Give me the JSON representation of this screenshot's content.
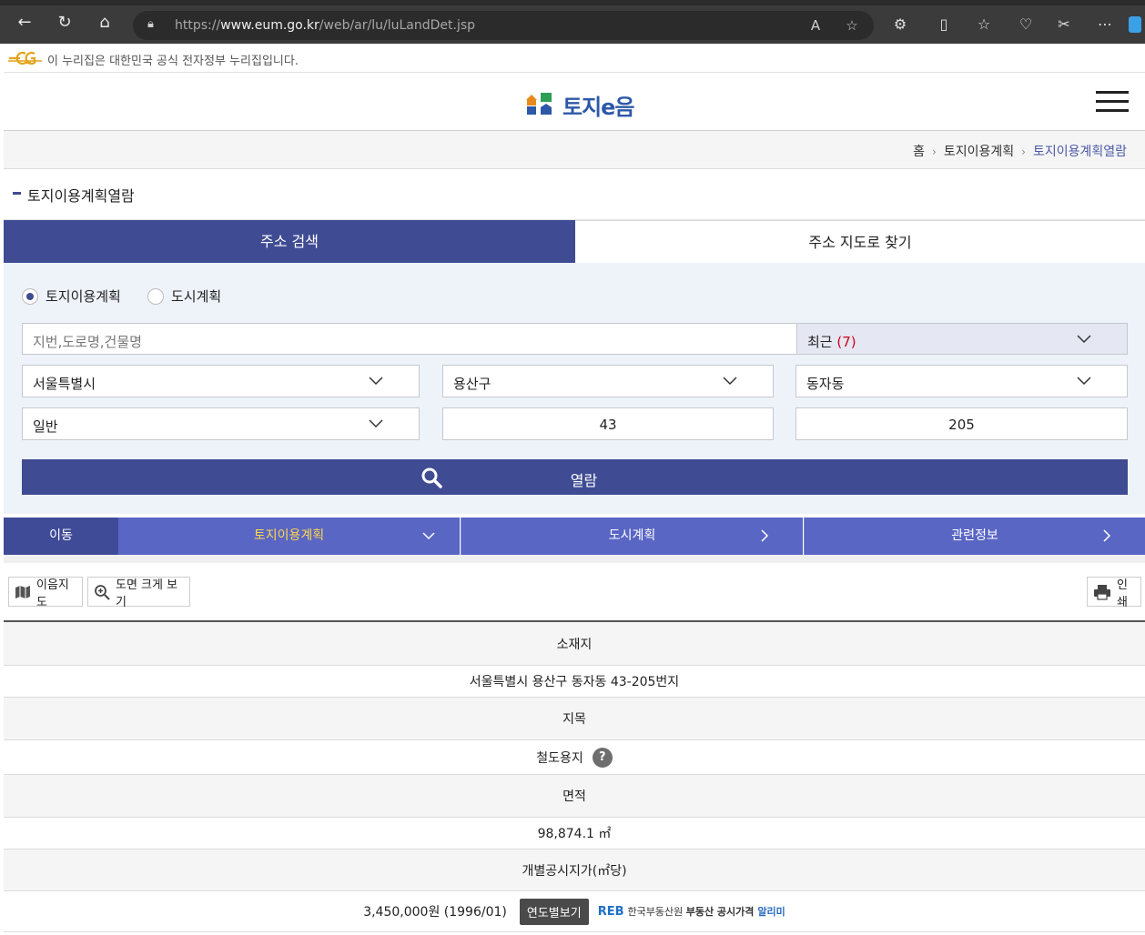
{
  "browser": {
    "url_prefix": "https://",
    "url_domain": "www.eum.go.kr",
    "url_path": "/web/ar/lu/luLandDet.jsp"
  },
  "gov_banner": "이 누리집은 대한민국 공식 전자정부 누리집입니다.",
  "logo_text": "토지e음",
  "breadcrumb": {
    "home": "홈",
    "level1": "토지이용계획",
    "current": "토지이용계획열람"
  },
  "page_title": "토지이용계획열람",
  "search_tabs": [
    "주소 검색",
    "주소 지도로 찾기"
  ],
  "radios": [
    "토지이용계획",
    "도시계획"
  ],
  "search": {
    "placeholder": "지번,도로명,건물명",
    "recent_label": "최근",
    "recent_count": "(7)",
    "sido": "서울특별시",
    "sigungu": "용산구",
    "dong": "동자동",
    "san": "일반",
    "bonbun": "43",
    "bubun": "205",
    "view_button": "열람"
  },
  "menu": {
    "label": "이동",
    "tabs": [
      "토지이용계획",
      "도시계획",
      "관련정보"
    ]
  },
  "tools": {
    "map": "이음지도",
    "zoom": "도면 크게 보기",
    "print": "인쇄"
  },
  "info": {
    "location_head": "소재지",
    "location": "서울특별시 용산구 동자동 43-205번지",
    "jimok_head": "지목",
    "jimok": "철도용지",
    "help": "?",
    "area_head": "면적",
    "area": "98,874.1 ㎡",
    "price_head": "개별공시지가(㎡당)",
    "price": "3,450,000원 (1996/01)",
    "year_button": "연도별보기",
    "reb_logo": "REB",
    "reb_org": "한국부동산원",
    "reb_service": "부동산 공시가격",
    "reb_alimi": "알리미"
  },
  "colors": {
    "primary": "#3f4b93",
    "menu": "#5a66c4",
    "selected_menu_text": "#ffd84a",
    "search_bg": "#eef3fa",
    "recent_count": "#d0021b"
  }
}
